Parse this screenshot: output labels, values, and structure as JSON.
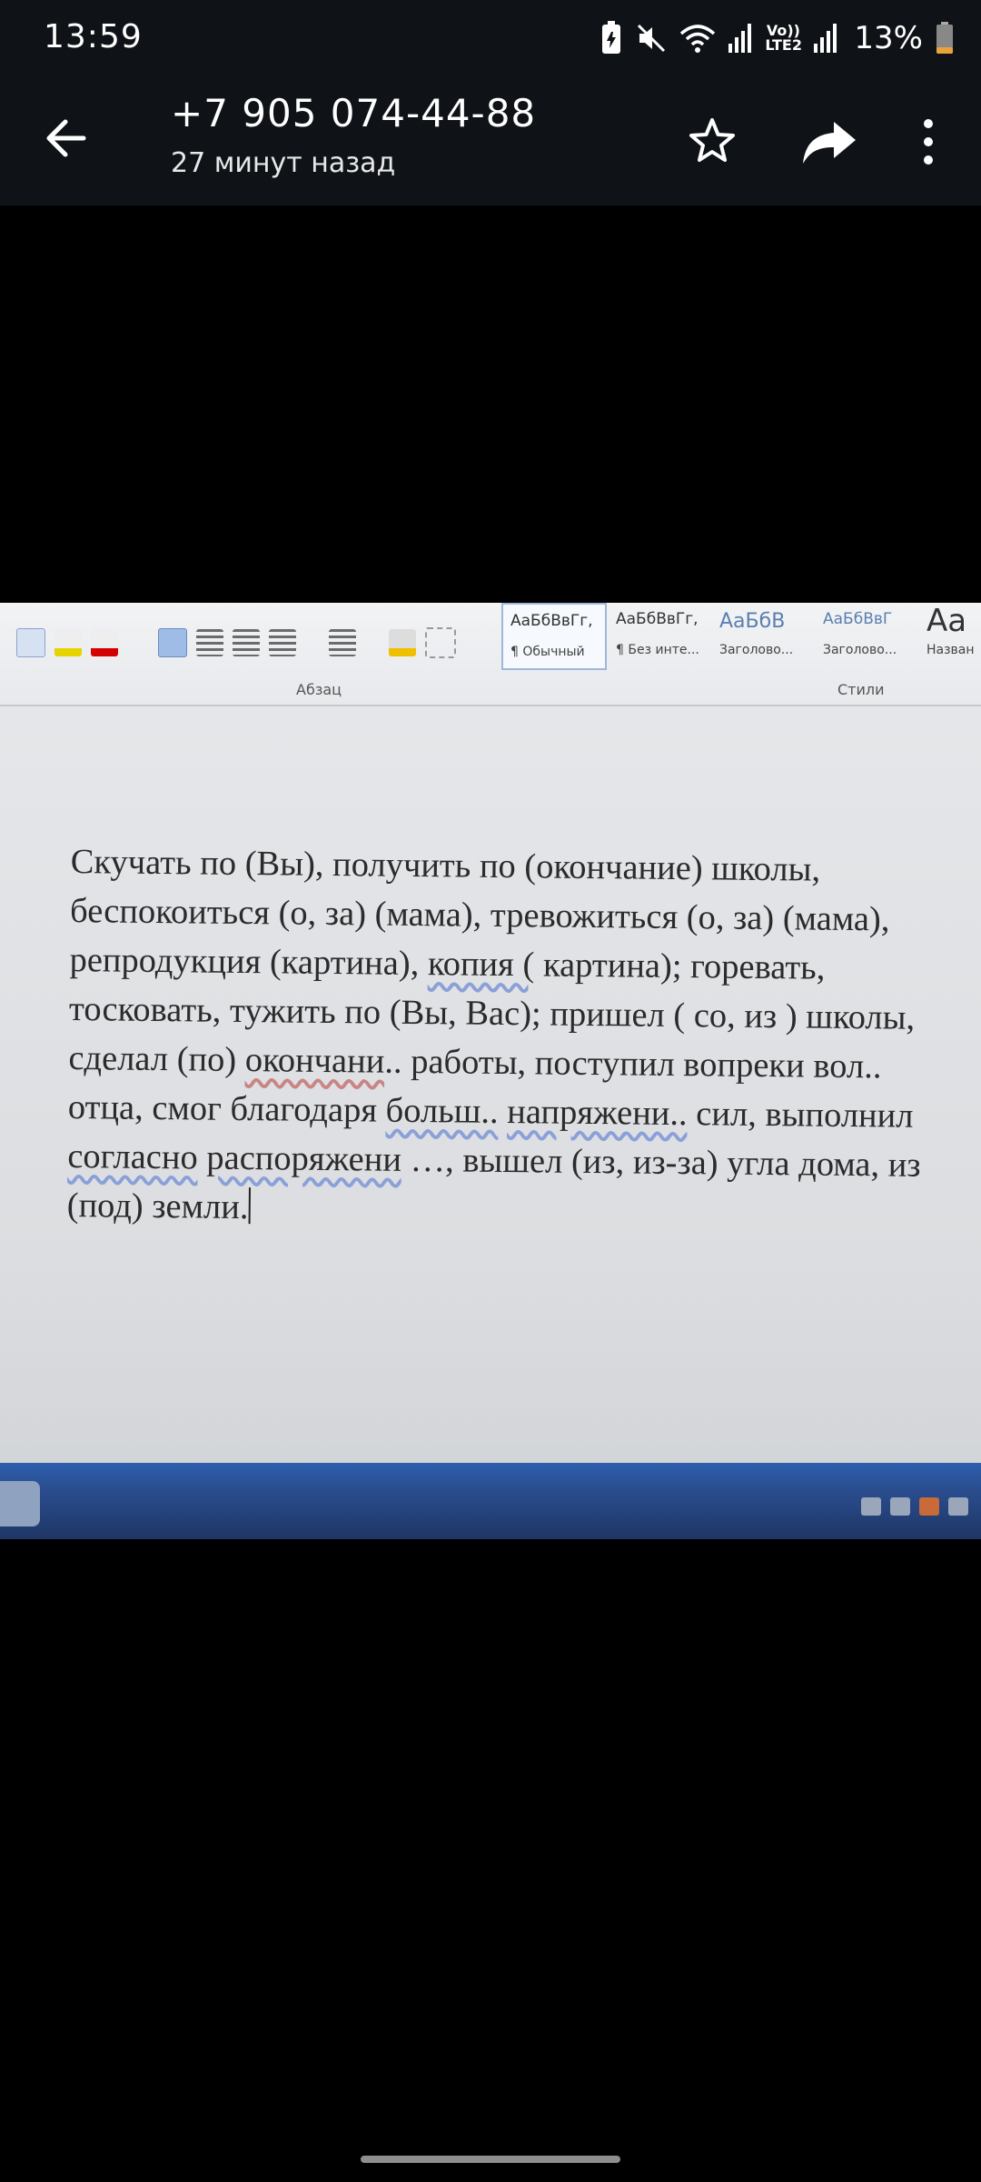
{
  "status_bar": {
    "time": "13:59",
    "battery": "13%",
    "network_label": "Vo)) LTE2",
    "icons": [
      "battery-saver-icon",
      "mute-icon",
      "wifi-icon",
      "signal-icon",
      "signal-icon",
      "battery-icon"
    ]
  },
  "header": {
    "title": "+7 905 074-44-88",
    "subtitle": "27 минут назад",
    "icons": [
      "back-arrow-icon",
      "star-icon",
      "share-icon",
      "more-vertical-icon"
    ]
  },
  "photo": {
    "ribbon": {
      "group_paragraph": "Абзац",
      "group_styles": "Стили",
      "styles": [
        {
          "sample": "АаБбВвГг,",
          "name": "¶ Обычный"
        },
        {
          "sample": "АаБбВвГг,",
          "name": "¶ Без инте..."
        },
        {
          "sample": "АаБбВ",
          "name": "Заголово..."
        },
        {
          "sample": "АаБбВвГ",
          "name": "Заголово..."
        },
        {
          "sample": "Аа",
          "name": "Назван"
        }
      ]
    },
    "document": {
      "seg1": "Скучать по (Вы), получить по (окончание) школы, беспокоиться (о, за) (мама), тревожиться (о, за) (мама), репродукция (картина), ",
      "seg2": "копия (",
      "seg3": " картина); горевать, тосковать, тужить по (Вы, Вас); пришел ( со, из ) школы, сделал (по) ",
      "seg4": "окончани",
      "seg5": ".. работы, поступил вопреки вол.. отца, смог благодаря ",
      "seg6": "больш..",
      "seg7": " ",
      "seg8": "напряжени..",
      "seg9": " сил, выполнил ",
      "seg10": "согласно",
      "seg11": " ",
      "seg12": "распоряжени",
      "seg13": " …, вышел (из, из-за) угла дома, из (под) земли."
    }
  }
}
